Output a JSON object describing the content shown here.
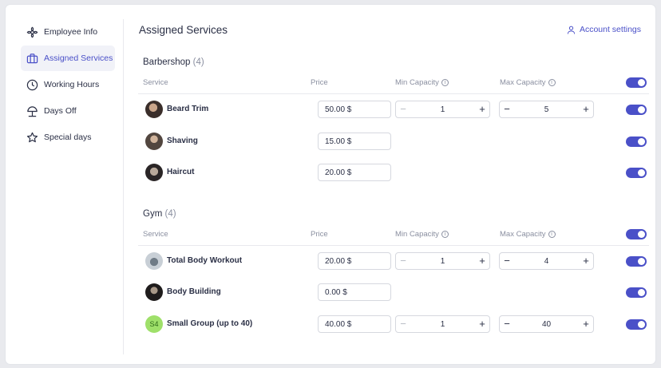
{
  "sidebar": {
    "items": [
      {
        "label": "Employee Info",
        "icon": "flower-icon"
      },
      {
        "label": "Assigned Services",
        "icon": "briefcase-icon"
      },
      {
        "label": "Working Hours",
        "icon": "clock-icon"
      },
      {
        "label": "Days Off",
        "icon": "beach-umbrella-icon"
      },
      {
        "label": "Special days",
        "icon": "star-icon"
      }
    ],
    "active_index": 1
  },
  "header": {
    "title": "Assigned Services",
    "account_settings": "Account settings"
  },
  "columns": {
    "service": "Service",
    "price": "Price",
    "min_capacity": "Min Capacity",
    "max_capacity": "Max Capacity"
  },
  "categories": [
    {
      "name": "Barbershop",
      "count": "(4)",
      "services": [
        {
          "name": "Beard Trim",
          "price": "50.00 $",
          "min": "1",
          "max": "5",
          "has_capacity": true,
          "enabled": true
        },
        {
          "name": "Shaving",
          "price": "15.00 $",
          "has_capacity": false,
          "enabled": true
        },
        {
          "name": "Haircut",
          "price": "20.00 $",
          "has_capacity": false,
          "enabled": true
        }
      ]
    },
    {
      "name": "Gym",
      "count": "(4)",
      "services": [
        {
          "name": "Total Body Workout",
          "price": "20.00 $",
          "min": "1",
          "max": "4",
          "has_capacity": true,
          "enabled": true
        },
        {
          "name": "Body Building",
          "price": "0.00 $",
          "has_capacity": false,
          "enabled": true
        },
        {
          "name": "Small Group (up to 40)",
          "initials": "S4",
          "price": "40.00 $",
          "min": "1",
          "max": "40",
          "has_capacity": true,
          "enabled": true
        }
      ]
    }
  ],
  "colors": {
    "accent": "#4a50c8",
    "avatar_initials_bg": "#9fe06a"
  }
}
